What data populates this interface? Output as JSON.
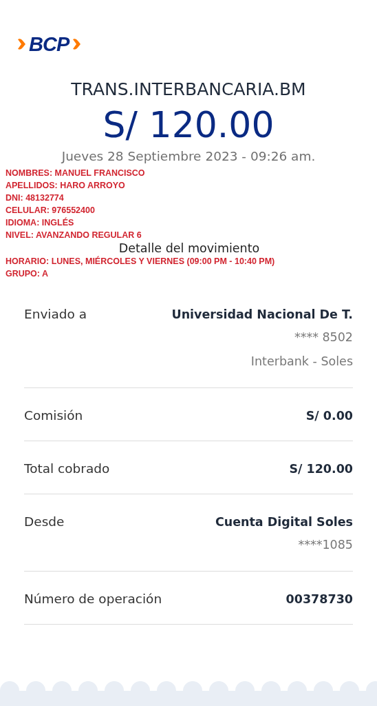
{
  "logo": {
    "text": "BCP"
  },
  "title": "TRANS.INTERBANCARIA.BM",
  "amount": "S/ 120.00",
  "date": "Jueves 28 Septiembre 2023 - 09:26 am.",
  "overlay_lines_top": [
    "NOMBRES: MANUEL FRANCISCO",
    "APELLIDOS: HARO ARROYO",
    "DNI: 48132774",
    "CELULAR: 976552400",
    "IDIOMA: INGLÉS",
    "NIVEL: AVANZANDO REGULAR 6"
  ],
  "section_title": "Detalle del movimiento",
  "overlay_lines_bottom": [
    "HORARIO: LUNES, MIÉRCOLES Y VIERNES (09:00 PM - 10:40 PM)",
    "GRUPO: A"
  ],
  "details": [
    {
      "label": "Enviado a",
      "value": "Universidad Nacional De T.",
      "extra": [
        "**** 8502",
        "Interbank - Soles"
      ]
    },
    {
      "label": "Comisión",
      "value": "S/ 0.00"
    },
    {
      "label": "Total cobrado",
      "value": "S/ 120.00"
    },
    {
      "label": "Desde",
      "value": "Cuenta Digital Soles",
      "extra": [
        "****1085"
      ]
    },
    {
      "label": "Número de operación",
      "value": "00378730"
    }
  ]
}
